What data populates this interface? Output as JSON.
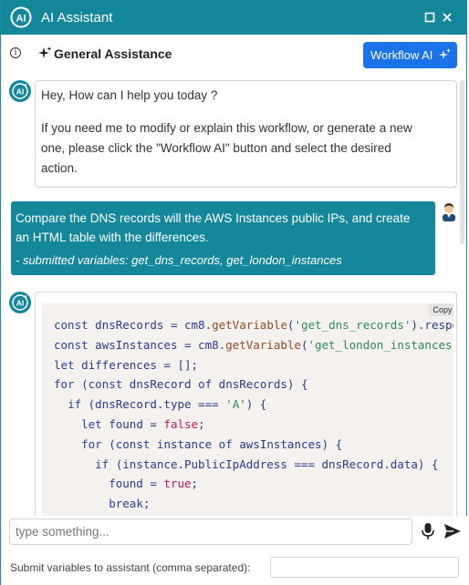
{
  "window": {
    "title": "AI Assistant",
    "colors": {
      "accent": "#14889a",
      "button": "#1a73e8"
    }
  },
  "header": {
    "info_icon": "info-icon",
    "title": "General Assistance",
    "title_icon": "sparkle-icon",
    "workflow_button_label": "Workflow AI",
    "workflow_button_icon": "sparkle-icon"
  },
  "messages": {
    "assistant_greeting": {
      "line1": "Hey, How can I help you today ?",
      "line2": "If you need me to modify or explain this workflow, or generate a new",
      "line3": "one, please click the \"Workflow AI\" button and select the desired",
      "line4": "action."
    },
    "user_request": {
      "line1": "Compare the DNS records will the AWS Instances public IPs, and create",
      "line2": "an HTML table with the differences.",
      "variables": "- submitted variables: get_dns_records, get_london_instances"
    },
    "assistant_code": {
      "copy_label": "Copy"
    }
  },
  "composer": {
    "placeholder": "type something...",
    "variables_label": "Submit variables to assistant (comma separated):",
    "variables_value": ""
  }
}
